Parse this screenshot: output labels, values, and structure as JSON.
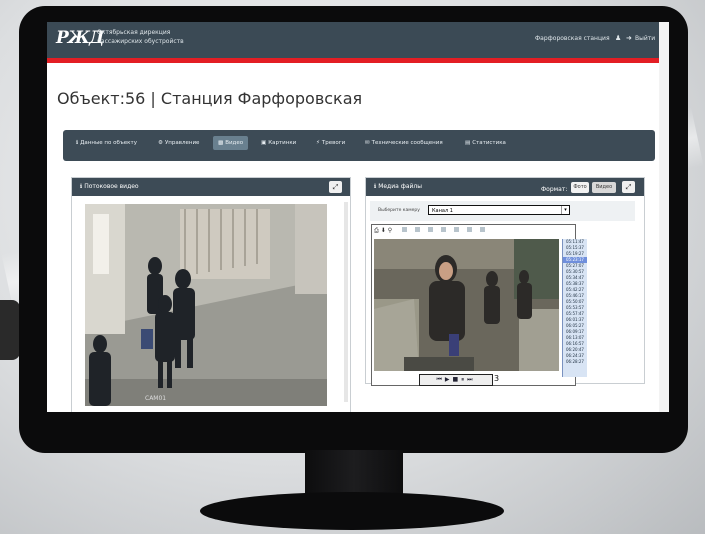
{
  "topbar": {
    "logo": "РЖД",
    "org_line1": "Октябрьская дирекция",
    "org_line2": "пассажирских обустройств",
    "station_link": "Фарфоровская станция",
    "user_icon": "user-icon",
    "exit_label": "Выйти"
  },
  "page": {
    "title": "Объект:56 | Станция Фарфоровская"
  },
  "tabs": [
    {
      "icon": "info-icon",
      "label": "Данные по объекту"
    },
    {
      "icon": "gear-icon",
      "label": "Управление"
    },
    {
      "icon": "camera-icon",
      "label": "Видео"
    },
    {
      "icon": "image-icon",
      "label": "Картинки"
    },
    {
      "icon": "bolt-icon",
      "label": "Тревоги"
    },
    {
      "icon": "message-icon",
      "label": "Технические сообщения"
    },
    {
      "icon": "chart-icon",
      "label": "Статистика"
    }
  ],
  "active_tab": "Видео",
  "left_panel": {
    "title": "Потоковое видео",
    "expand_icon": "expand-icon"
  },
  "right_panel": {
    "title": "Медиа файлы",
    "format_label": "Формат:",
    "format_options": [
      "Фото",
      "Видео"
    ],
    "channel_label": "Выберите камеру",
    "channel_value": "Канал 1"
  },
  "player": {
    "toolbar_icons": [
      "print-icon",
      "save-icon",
      "zoom-icon"
    ],
    "timestamps": [
      "05:11:47",
      "05:15:37",
      "05:19:27",
      "05:23:17",
      "05:27:07",
      "05:30:57",
      "05:34:47",
      "05:38:37",
      "05:42:27",
      "05:46:17",
      "05:50:07",
      "05:53:57",
      "05:57:47",
      "06:01:37",
      "06:05:27",
      "06:09:17",
      "06:13:07",
      "06:16:57",
      "06:20:47",
      "06:24:37",
      "06:28:27"
    ],
    "selected_index": 3,
    "controls": [
      "⏮",
      "▶",
      "■",
      "⏸",
      "⏭"
    ],
    "annotation": "3"
  },
  "colors": {
    "header": "#3b4a55",
    "accent": "#e31e24",
    "tabbar": "#3d4b56"
  }
}
